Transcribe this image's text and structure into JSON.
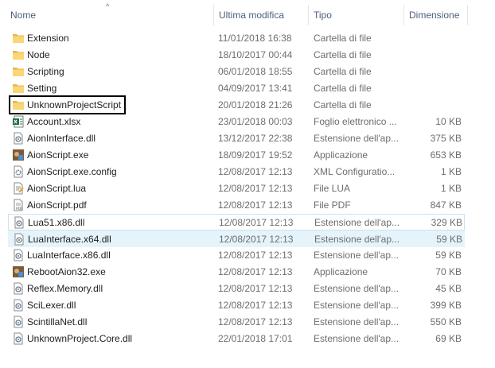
{
  "columns": {
    "name": "Nome",
    "modified": "Ultima modifica",
    "type": "Tipo",
    "size": "Dimensione"
  },
  "sort_indicator": "^",
  "files": [
    {
      "name": "Extension",
      "modified": "11/01/2018 16:38",
      "type": "Cartella di file",
      "size": "",
      "icon": "folder-icon"
    },
    {
      "name": "Node",
      "modified": "18/10/2017 00:44",
      "type": "Cartella di file",
      "size": "",
      "icon": "folder-icon"
    },
    {
      "name": "Scripting",
      "modified": "06/01/2018 18:55",
      "type": "Cartella di file",
      "size": "",
      "icon": "folder-icon"
    },
    {
      "name": "Setting",
      "modified": "04/09/2017 13:41",
      "type": "Cartella di file",
      "size": "",
      "icon": "folder-icon"
    },
    {
      "name": "UnknownProjectScript",
      "modified": "20/01/2018 21:26",
      "type": "Cartella di file",
      "size": "",
      "icon": "folder-icon"
    },
    {
      "name": "Account.xlsx",
      "modified": "23/01/2018 00:03",
      "type": "Foglio elettronico ...",
      "size": "10 KB",
      "icon": "excel-file-icon"
    },
    {
      "name": "AionInterface.dll",
      "modified": "13/12/2017 22:38",
      "type": "Estensione dell'ap...",
      "size": "375 KB",
      "icon": "dll-file-icon"
    },
    {
      "name": "AionScript.exe",
      "modified": "18/09/2017 19:52",
      "type": "Applicazione",
      "size": "653 KB",
      "icon": "app-exe-icon"
    },
    {
      "name": "AionScript.exe.config",
      "modified": "12/08/2017 12:13",
      "type": "XML Configuratio...",
      "size": "1 KB",
      "icon": "config-file-icon"
    },
    {
      "name": "AionScript.lua",
      "modified": "12/08/2017 12:13",
      "type": "File LUA",
      "size": "1 KB",
      "icon": "lua-file-icon"
    },
    {
      "name": "AionScript.pdf",
      "modified": "12/08/2017 12:13",
      "type": "File PDF",
      "size": "847 KB",
      "icon": "pdf-file-icon"
    },
    {
      "name": "Lua51.x86.dll",
      "modified": "12/08/2017 12:13",
      "type": "Estensione dell'ap...",
      "size": "329 KB",
      "icon": "dll-file-icon"
    },
    {
      "name": "LuaInterface.x64.dll",
      "modified": "12/08/2017 12:13",
      "type": "Estensione dell'ap...",
      "size": "59 KB",
      "icon": "dll-file-icon"
    },
    {
      "name": "LuaInterface.x86.dll",
      "modified": "12/08/2017 12:13",
      "type": "Estensione dell'ap...",
      "size": "59 KB",
      "icon": "dll-file-icon"
    },
    {
      "name": "RebootAion32.exe",
      "modified": "12/08/2017 12:13",
      "type": "Applicazione",
      "size": "70 KB",
      "icon": "app-exe-icon"
    },
    {
      "name": "Reflex.Memory.dll",
      "modified": "12/08/2017 12:13",
      "type": "Estensione dell'ap...",
      "size": "45 KB",
      "icon": "dll-file-icon"
    },
    {
      "name": "SciLexer.dll",
      "modified": "12/08/2017 12:13",
      "type": "Estensione dell'ap...",
      "size": "399 KB",
      "icon": "dll-file-icon"
    },
    {
      "name": "ScintillaNet.dll",
      "modified": "12/08/2017 12:13",
      "type": "Estensione dell'ap...",
      "size": "550 KB",
      "icon": "dll-file-icon"
    },
    {
      "name": "UnknownProject.Core.dll",
      "modified": "22/01/2018 17:01",
      "type": "Estensione dell'ap...",
      "size": "69 KB",
      "icon": "dll-file-icon"
    }
  ],
  "hovered_index": 11,
  "selected_index": 12,
  "highlighted_index": 4,
  "colors": {
    "header_text": "#4c607a",
    "selection": "#e5f3fb",
    "hover_border": "#c9e2f3",
    "folder": "#f6cf5a",
    "secondary_text": "#6d6d6d"
  }
}
